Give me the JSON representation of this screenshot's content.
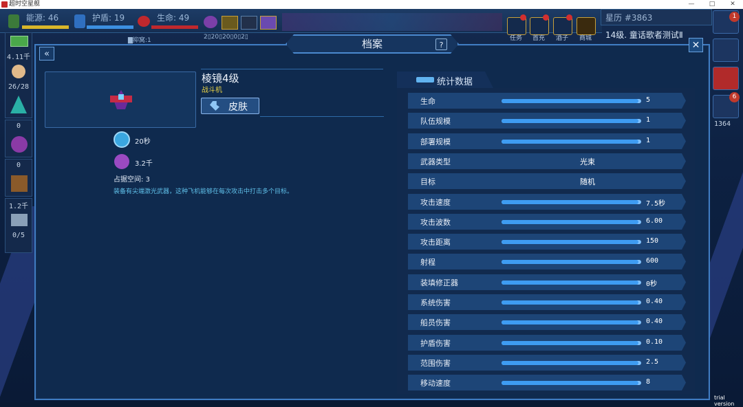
{
  "window": {
    "title": "超时空星舰",
    "minimize": "—",
    "maximize": "□",
    "close": "✕"
  },
  "hud": {
    "energy": {
      "label": "能源:",
      "value": "46"
    },
    "shield": {
      "label": "护盾:",
      "value": "19"
    },
    "health": {
      "label": "生命:",
      "value": "49"
    },
    "storage_label": "▇抑窝:1",
    "storage_sub": "2▯20▯20▯0▯2▯",
    "buttons": [
      {
        "name": "mission",
        "label": "任务"
      },
      {
        "name": "recharge",
        "label": "首充"
      },
      {
        "name": "tavern",
        "label": "酒子"
      },
      {
        "name": "shop",
        "label": "商城"
      }
    ],
    "star_calendar": "星历 #3863",
    "level_text": "14级. 童话歌者测试Ⅱ"
  },
  "left_sidebar": [
    {
      "name": "money",
      "value": "4.11千"
    },
    {
      "name": "crew",
      "value": "26/28"
    },
    {
      "name": "crystal",
      "value": "0"
    },
    {
      "name": "orb",
      "value": "0"
    },
    {
      "name": "crate",
      "value": "1.2千"
    },
    {
      "name": "workshop",
      "value": "0/5"
    }
  ],
  "right_sidebar": {
    "chat_badge": "1",
    "trophy_badge": "6",
    "trophy_count": "1364"
  },
  "dialog": {
    "title": "档案",
    "help": "?",
    "back": "«",
    "close": "✕",
    "ship_name": "棱镜4级",
    "ship_type": "战斗机",
    "skin_button": "皮肤",
    "build_time": "20秒",
    "cost": "3.2千",
    "space_label": "占据空间:",
    "space_value": "3",
    "description": "装备有尖端激光武器，这种飞机能够在每次攻击中打击多个目标。"
  },
  "stats": {
    "title": "统计数据",
    "rows": [
      {
        "label": "生命",
        "value": "5",
        "fill": 0.98
      },
      {
        "label": "队伍规模",
        "value": "1",
        "fill": 0.98
      },
      {
        "label": "部署规模",
        "value": "1",
        "fill": 0.98
      },
      {
        "label": "武器类型",
        "value": "光束"
      },
      {
        "label": "目标",
        "value": "随机"
      },
      {
        "label": "攻击速度",
        "value": "7.5秒",
        "fill": 0.98
      },
      {
        "label": "攻击波数",
        "value": "6.00",
        "fill": 0.98
      },
      {
        "label": "攻击距离",
        "value": "150",
        "fill": 0.98
      },
      {
        "label": "射程",
        "value": "600",
        "fill": 0.98
      },
      {
        "label": "装填修正器",
        "value": "0秒",
        "fill": 0.98
      },
      {
        "label": "系统伤害",
        "value": "0.40",
        "fill": 0.98
      },
      {
        "label": "船员伤害",
        "value": "0.40",
        "fill": 0.98
      },
      {
        "label": "护盾伤害",
        "value": "0.10",
        "fill": 0.98
      },
      {
        "label": "范围伤害",
        "value": "2.5",
        "fill": 0.98
      },
      {
        "label": "移动速度",
        "value": "8",
        "fill": 0.98
      }
    ]
  },
  "watermark": "trial version",
  "colors": {
    "accent": "#3e9cf2",
    "panel": "#1d4577",
    "ship_type": "#e8d145",
    "description": "#5fbfe8"
  }
}
